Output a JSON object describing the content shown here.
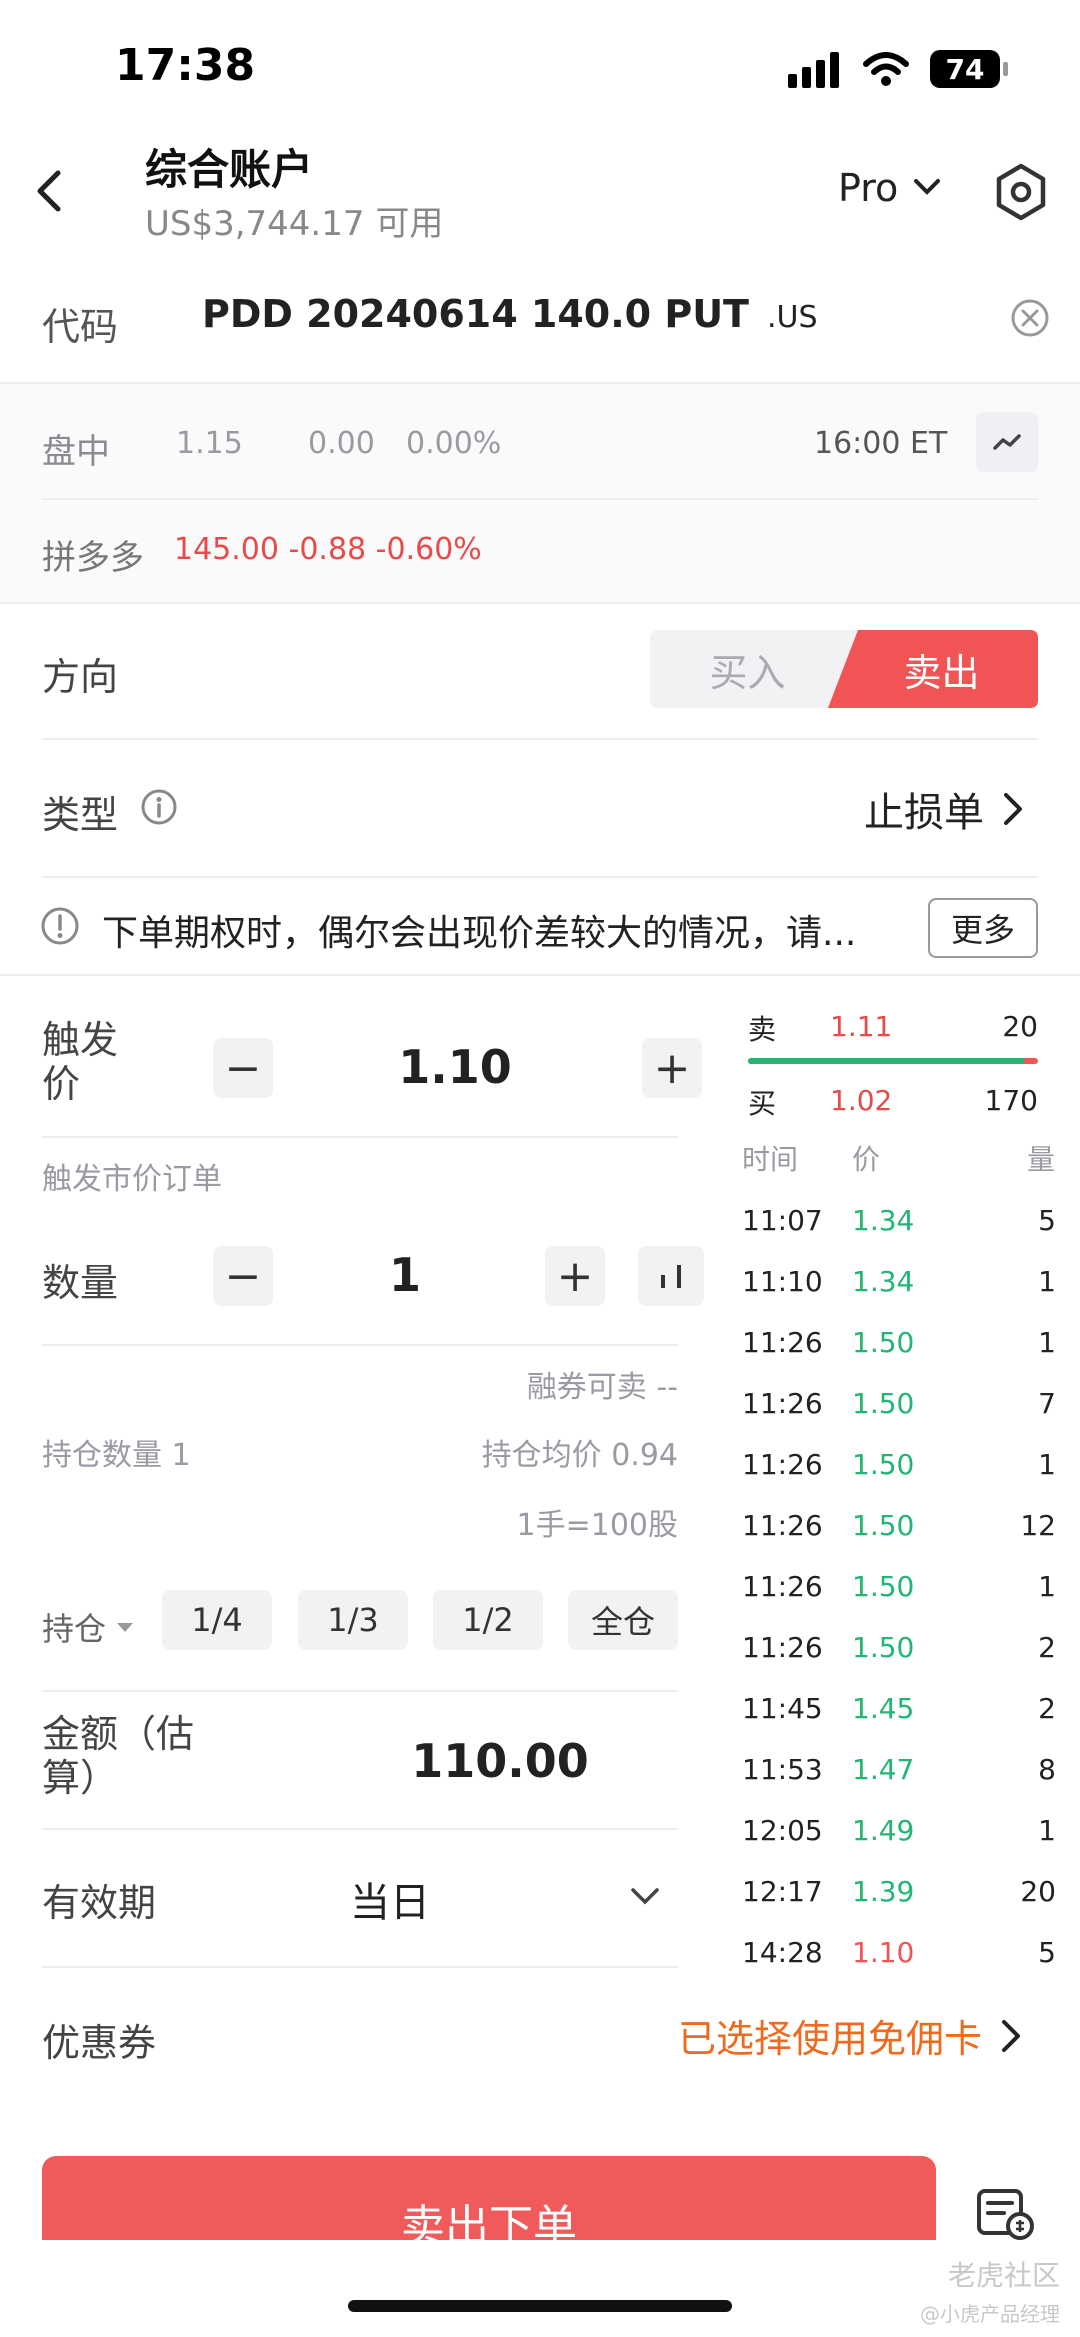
{
  "status_bar": {
    "time": "17:38",
    "battery": "74"
  },
  "header": {
    "title": "综合账户",
    "subtitle": "US$3,744.17 可用",
    "mode_label": "Pro"
  },
  "code_row": {
    "label": "代码",
    "symbol": "PDD 20240614 140.0 PUT",
    "market": ".US"
  },
  "quote": {
    "session": "盘中",
    "price": "1.15",
    "change": "0.00",
    "change_pct": "0.00%",
    "time": "16:00 ET"
  },
  "underlying": {
    "name": "拼多多",
    "quote": "145.00 -0.88 -0.60%"
  },
  "direction": {
    "label": "方向",
    "buy": "买入",
    "sell": "卖出"
  },
  "order_type": {
    "label": "类型",
    "value": "止损单"
  },
  "notice": {
    "text": "下单期权时，偶尔会出现价差较大的情况，请...",
    "more": "更多"
  },
  "trigger": {
    "label_line1": "触发",
    "label_line2": "价",
    "value": "1.10",
    "hint": "触发市价订单"
  },
  "quantity": {
    "label": "数量",
    "value": "1"
  },
  "info": {
    "margin_sell": "融券可卖 --",
    "position_qty": "持仓数量 1",
    "avg_price": "持仓均价 0.94",
    "lot": "1手=100股"
  },
  "position": {
    "label": "持仓",
    "options": [
      "1/4",
      "1/3",
      "1/2",
      "全仓"
    ]
  },
  "amount": {
    "label_line1": "金额（估",
    "label_line2": "算）",
    "value": "110.00"
  },
  "validity": {
    "label": "有效期",
    "value": "当日"
  },
  "coupon": {
    "label": "优惠券",
    "value": "已选择使用免佣卡"
  },
  "submit": {
    "label": "卖出下单"
  },
  "orderbook": {
    "ask_label": "卖",
    "ask_price": "1.11",
    "ask_qty": "20",
    "bid_label": "买",
    "bid_price": "1.02",
    "bid_qty": "170",
    "bid_fraction": 0.95
  },
  "trades": {
    "headers": [
      "时间",
      "价",
      "量"
    ],
    "rows": [
      {
        "time": "11:07",
        "price": "1.34",
        "qty": "5",
        "color": "green"
      },
      {
        "time": "11:10",
        "price": "1.34",
        "qty": "1",
        "color": "green"
      },
      {
        "time": "11:26",
        "price": "1.50",
        "qty": "1",
        "color": "green"
      },
      {
        "time": "11:26",
        "price": "1.50",
        "qty": "7",
        "color": "green"
      },
      {
        "time": "11:26",
        "price": "1.50",
        "qty": "1",
        "color": "green"
      },
      {
        "time": "11:26",
        "price": "1.50",
        "qty": "12",
        "color": "green"
      },
      {
        "time": "11:26",
        "price": "1.50",
        "qty": "1",
        "color": "green"
      },
      {
        "time": "11:26",
        "price": "1.50",
        "qty": "2",
        "color": "green"
      },
      {
        "time": "11:45",
        "price": "1.45",
        "qty": "2",
        "color": "green"
      },
      {
        "time": "11:53",
        "price": "1.47",
        "qty": "8",
        "color": "green"
      },
      {
        "time": "12:05",
        "price": "1.49",
        "qty": "1",
        "color": "green"
      },
      {
        "time": "12:17",
        "price": "1.39",
        "qty": "20",
        "color": "green"
      },
      {
        "time": "14:28",
        "price": "1.10",
        "qty": "5",
        "color": "red"
      }
    ]
  },
  "watermark": {
    "line1": "老虎社区",
    "line2": "@小虎产品经理"
  },
  "colors": {
    "sell_red": "#f05454",
    "up_green": "#22b573",
    "accent_orange": "#f06a1e"
  }
}
